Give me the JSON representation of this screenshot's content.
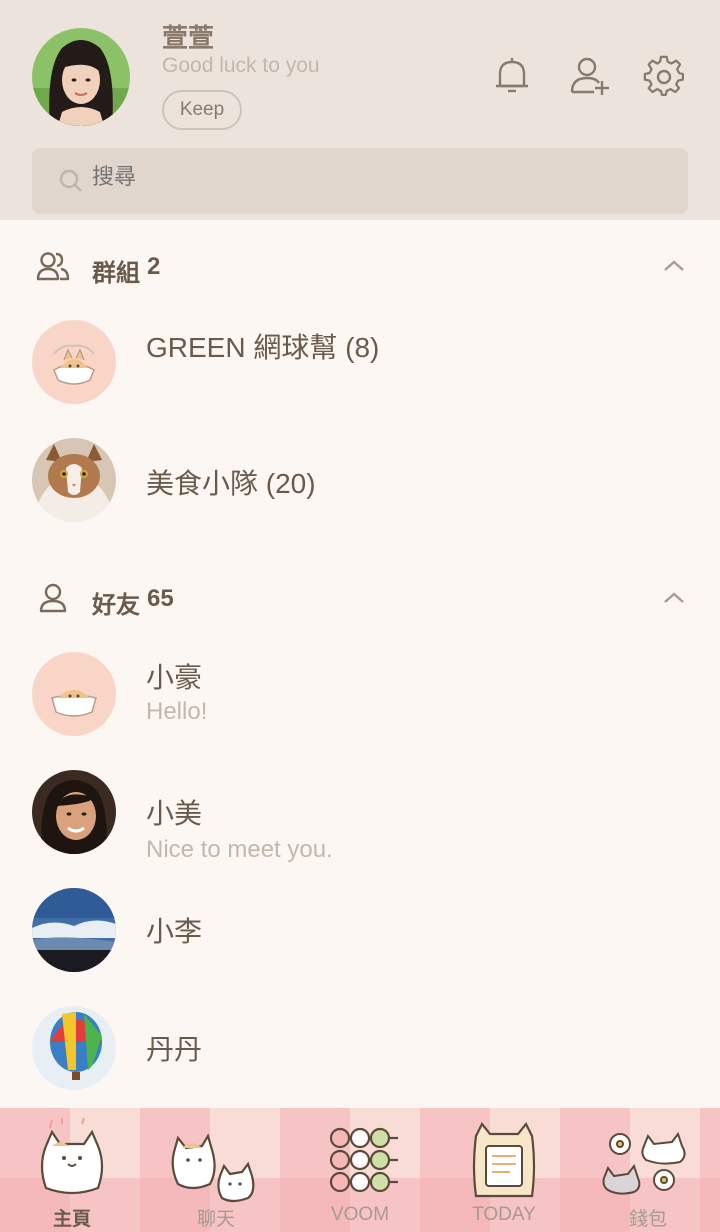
{
  "profile": {
    "name": "萱萱",
    "status": "Good luck to you",
    "keep_label": "Keep"
  },
  "header_icons": [
    "bell-icon",
    "add-friend-icon",
    "settings-gear-icon"
  ],
  "search": {
    "placeholder": "搜尋",
    "icon": "search-icon"
  },
  "groups_section": {
    "label": "群組",
    "count": "2",
    "items": [
      {
        "name": "GREEN 網球幫 (8)"
      },
      {
        "name": "美食小隊 (20)"
      }
    ]
  },
  "friends_section": {
    "label": "好友",
    "count": "65",
    "items": [
      {
        "name": "小豪",
        "status": "Hello!"
      },
      {
        "name": "小美",
        "status": "Nice to meet you."
      },
      {
        "name": "小李"
      },
      {
        "name": "丹丹"
      }
    ]
  },
  "tabs": [
    {
      "label": "主頁",
      "active": true
    },
    {
      "label": "聊天"
    },
    {
      "label": "VOOM"
    },
    {
      "label": "TODAY"
    },
    {
      "label": "錢包"
    }
  ],
  "colors": {
    "header_bg": "#ece3dc",
    "page_bg": "#fdf7f4",
    "text_primary": "#6a5a4c",
    "text_secondary": "#c3b7ac",
    "tab_bar_pink": "#f4b0b4"
  }
}
